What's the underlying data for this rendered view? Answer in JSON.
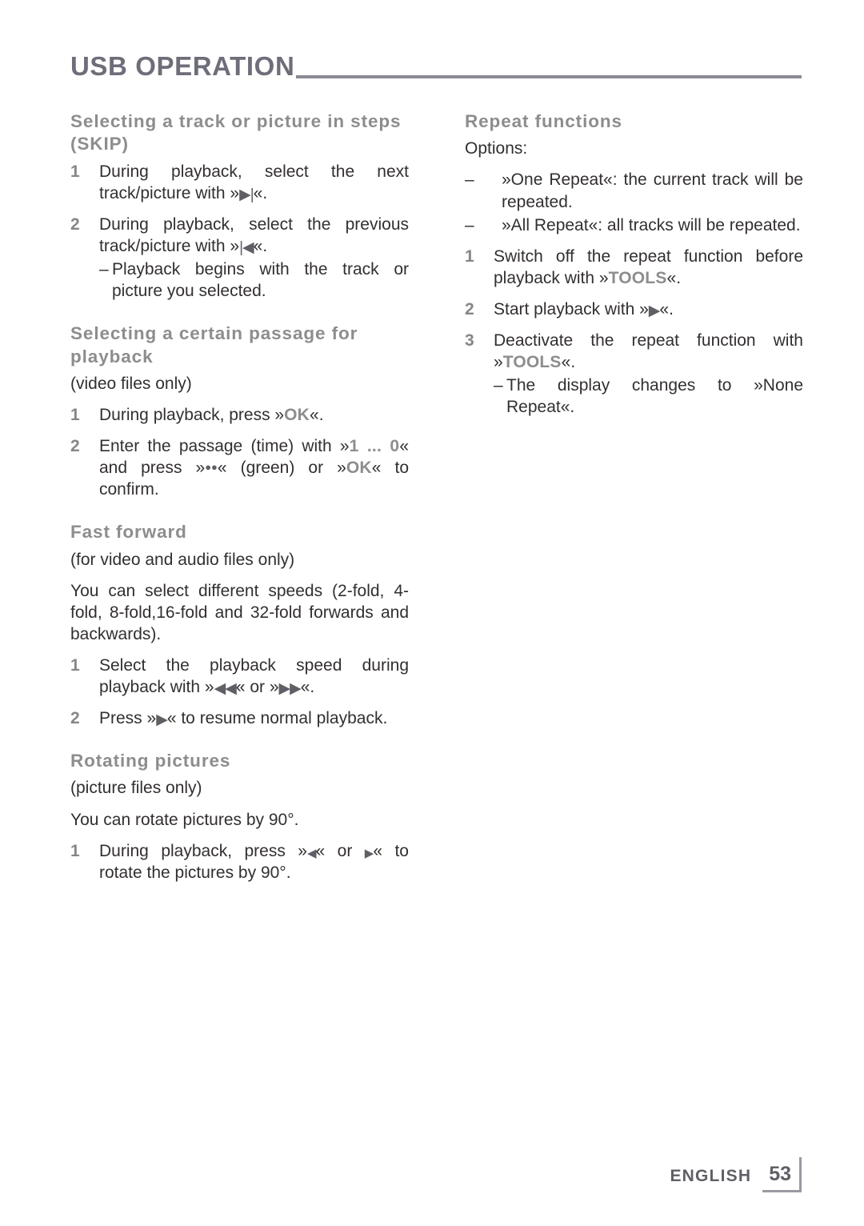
{
  "header": {
    "title": "USB OPERATION"
  },
  "left_column": [
    {
      "heading": "Selecting a track or picture in steps (SKIP)",
      "items": [
        {
          "num": "1",
          "parts": [
            {
              "t": "text",
              "v": "During playback, select the next track/picture with »"
            },
            {
              "t": "glyph",
              "v": "▶|"
            },
            {
              "t": "text",
              "v": "«."
            }
          ]
        },
        {
          "num": "2",
          "parts": [
            {
              "t": "text",
              "v": "During playback, select the previous track/picture with »"
            },
            {
              "t": "glyph",
              "v": "|◀"
            },
            {
              "t": "text",
              "v": "«."
            }
          ],
          "dash": "Playback begins with the track or picture you selected."
        }
      ]
    },
    {
      "heading": "Selecting a certain passage for playback",
      "note": "(video files only)",
      "items": [
        {
          "num": "1",
          "parts": [
            {
              "t": "text",
              "v": "During playback, press »"
            },
            {
              "t": "key",
              "v": "OK"
            },
            {
              "t": "text",
              "v": "«."
            }
          ]
        },
        {
          "num": "2",
          "parts": [
            {
              "t": "text",
              "v": "Enter the passage (time) with »"
            },
            {
              "t": "key",
              "v": "1 ... 0"
            },
            {
              "t": "text",
              "v": "« and press »"
            },
            {
              "t": "dots",
              "v": "●●"
            },
            {
              "t": "text",
              "v": "« (green) or »"
            },
            {
              "t": "key",
              "v": "OK"
            },
            {
              "t": "text",
              "v": "« to confirm."
            }
          ]
        }
      ]
    },
    {
      "heading": "Fast forward",
      "note": "(for video and audio files only)",
      "para": "You can select different speeds (2-fold, 4-fold, 8-fold,16-fold and 32-fold forwards and backwards).",
      "items": [
        {
          "num": "1",
          "parts": [
            {
              "t": "text",
              "v": "Select the playback speed during playback with »"
            },
            {
              "t": "glyph",
              "v": "◀◀"
            },
            {
              "t": "text",
              "v": "« or »"
            },
            {
              "t": "glyph",
              "v": "▶▶"
            },
            {
              "t": "text",
              "v": "«."
            }
          ]
        },
        {
          "num": "2",
          "parts": [
            {
              "t": "text",
              "v": "Press »"
            },
            {
              "t": "glyph",
              "v": "▶"
            },
            {
              "t": "text",
              "v": "« to resume normal playback."
            }
          ]
        }
      ]
    },
    {
      "heading": "Rotating pictures",
      "note": "(picture files only)",
      "para": "You can rotate pictures by 90°.",
      "items": [
        {
          "num": "1",
          "parts": [
            {
              "t": "text",
              "v": "During playback, press »"
            },
            {
              "t": "glyph_sm",
              "v": "◀"
            },
            {
              "t": "text",
              "v": "« or "
            },
            {
              "t": "glyph_sm",
              "v": "▶"
            },
            {
              "t": "text",
              "v": "« to rotate the pictures by 90°."
            }
          ]
        }
      ]
    }
  ],
  "right_column": [
    {
      "heading": "Repeat functions",
      "note": "Options:",
      "options": [
        "»One Repeat«: the current track will be repeated.",
        "»All Repeat«: all tracks will be repeated."
      ],
      "items": [
        {
          "num": "1",
          "parts": [
            {
              "t": "text",
              "v": "Switch off the repeat function before playback with »"
            },
            {
              "t": "key",
              "v": "TOOLS"
            },
            {
              "t": "text",
              "v": "«."
            }
          ]
        },
        {
          "num": "2",
          "parts": [
            {
              "t": "text",
              "v": "Start playback with »"
            },
            {
              "t": "glyph",
              "v": "▶"
            },
            {
              "t": "text",
              "v": "«."
            }
          ]
        },
        {
          "num": "3",
          "parts": [
            {
              "t": "text",
              "v": "Deactivate the repeat function with »"
            },
            {
              "t": "key",
              "v": "TOOLS"
            },
            {
              "t": "text",
              "v": "«."
            }
          ],
          "dash": "The display changes to »None Repeat«."
        }
      ]
    }
  ],
  "footer": {
    "language": "ENGLISH",
    "page_number": "53"
  },
  "colors": {
    "heading_purple_gray": "#6e6e7a",
    "section_gray": "#8d8d8d",
    "body_dark": "#332f2f",
    "rule_gray": "#8a8a93"
  }
}
